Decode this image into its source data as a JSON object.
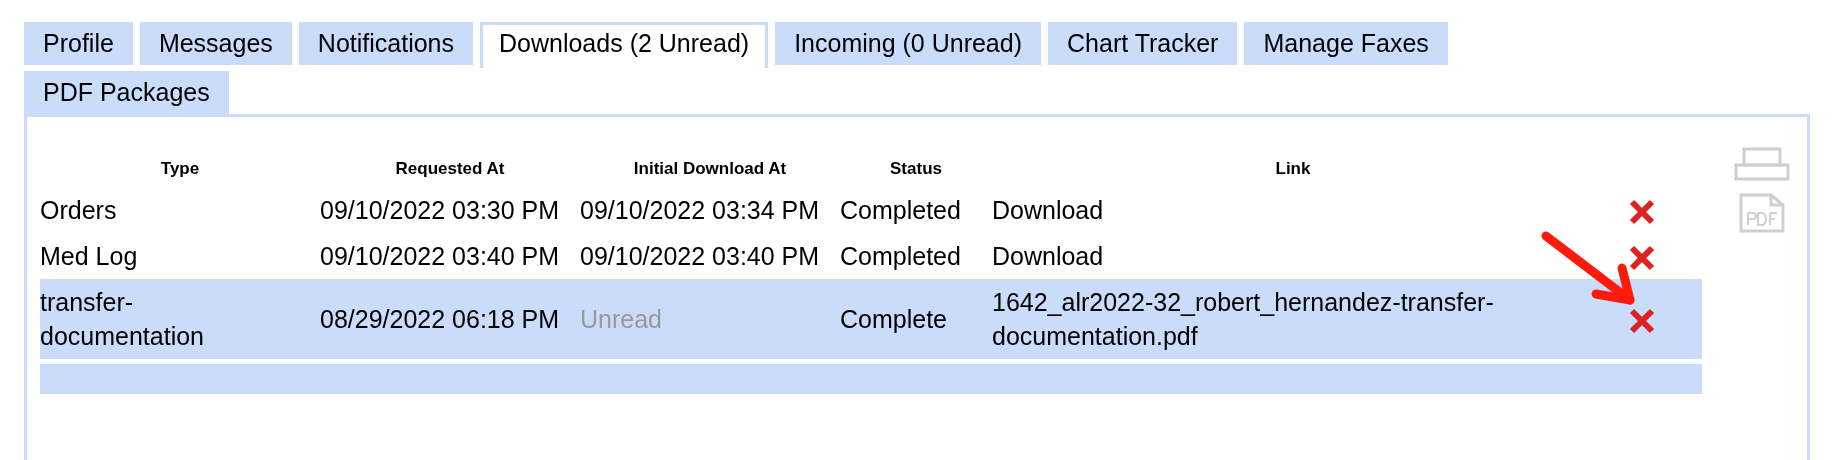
{
  "tabs": [
    {
      "label": "Profile",
      "selected": false
    },
    {
      "label": "Messages",
      "selected": false
    },
    {
      "label": "Notifications",
      "selected": false
    },
    {
      "label": "Downloads (2 Unread)",
      "selected": true
    },
    {
      "label": "Incoming (0 Unread)",
      "selected": false
    },
    {
      "label": "Chart Tracker",
      "selected": false
    },
    {
      "label": "Manage Faxes",
      "selected": false
    },
    {
      "label": "PDF Packages",
      "selected": false
    }
  ],
  "table": {
    "columns": [
      "Type",
      "Requested At",
      "Initial Download At",
      "Status",
      "Link"
    ],
    "rows": [
      {
        "type": "Orders",
        "requested_at": "09/10/2022 03:30 PM",
        "initial_download_at": "09/10/2022 03:34 PM",
        "downloaded": true,
        "status": "Completed",
        "link": "Download",
        "selected": false
      },
      {
        "type": "Med Log",
        "requested_at": "09/10/2022 03:40 PM",
        "initial_download_at": "09/10/2022 03:40 PM",
        "downloaded": true,
        "status": "Completed",
        "link": "Download",
        "selected": false
      },
      {
        "type": "transfer-documentation",
        "requested_at": "08/29/2022 06:18 PM",
        "initial_download_at": "Unread",
        "downloaded": false,
        "status": "Complete",
        "link": "1642_alr2022-32_robert_hernandez-transfer-documentation.pdf",
        "selected": true
      }
    ]
  }
}
